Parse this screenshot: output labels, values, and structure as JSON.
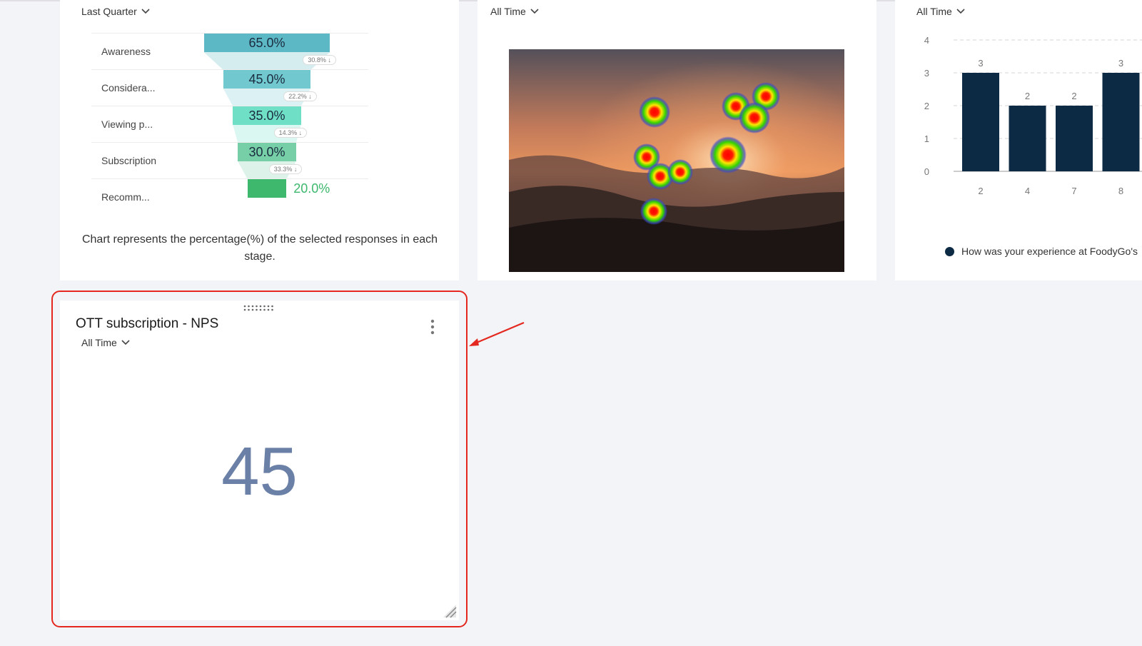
{
  "funnel_card": {
    "filter_label": "Last Quarter",
    "stages": [
      {
        "label": "Awareness",
        "value": "65.0%",
        "pct": 65.0,
        "color": "#5db8c5",
        "drop": "30.8%"
      },
      {
        "label": "Considera...",
        "value": "45.0%",
        "pct": 45.0,
        "color": "#71c9cf",
        "drop": "22.2%"
      },
      {
        "label": "Viewing p...",
        "value": "35.0%",
        "pct": 35.0,
        "color": "#6fdfc6",
        "drop": "14.3%"
      },
      {
        "label": "Subscription",
        "value": "30.0%",
        "pct": 30.0,
        "color": "#76cfa6",
        "drop": "33.3%"
      },
      {
        "label": "Recomm...",
        "value": "20.0%",
        "pct": 20.0,
        "color": "#3db86d",
        "drop": ""
      }
    ],
    "note": "Chart represents the percentage(%) of the selected responses in each stage."
  },
  "heatmap_card": {
    "filter_label": "All Time"
  },
  "bar_card": {
    "filter_label": "All Time",
    "legend": "How was your experience at FoodyGo's",
    "bar_color": "#0c2a43"
  },
  "chart_data": {
    "type": "bar",
    "categories": [
      "2",
      "4",
      "7",
      "8"
    ],
    "values": [
      3,
      2,
      2,
      3
    ],
    "ylim": [
      0,
      4
    ],
    "yticks": [
      "0",
      "1",
      "2",
      "3",
      "4"
    ],
    "grid": true,
    "legend_position": "bottom"
  },
  "nps_card": {
    "title": "OTT subscription - NPS",
    "filter_label": "All Time",
    "value": "45"
  },
  "icons": {
    "chevron": "chevron-down-icon",
    "menu": "kebab-menu-icon",
    "drag": "drag-handle-icon",
    "resize": "resize-handle-icon"
  },
  "colors": {
    "highlight": "#e4281f",
    "nps_value": "#6a80a6",
    "background": "#f3f4f8"
  }
}
